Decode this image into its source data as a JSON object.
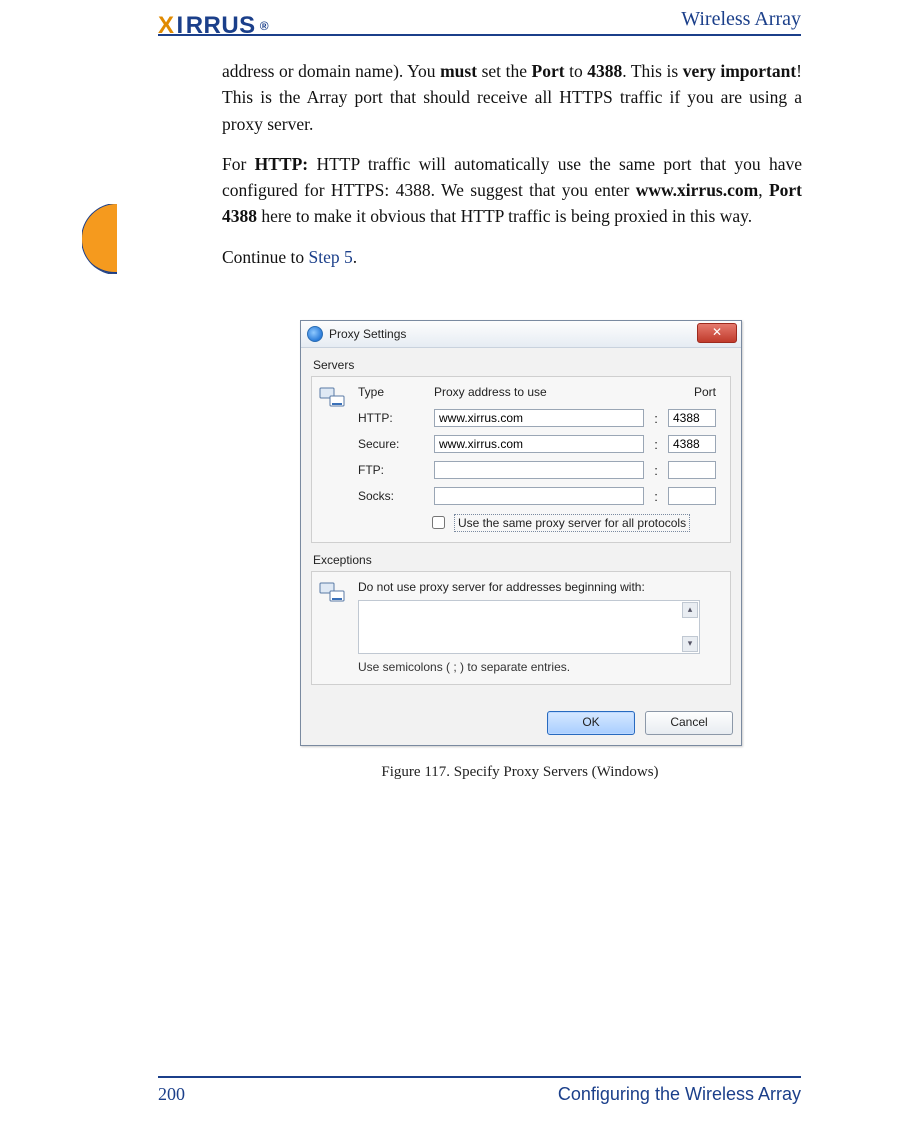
{
  "header": {
    "logo_text_1": "X",
    "logo_text_2": "I",
    "logo_text_3": "RRUS",
    "reg": "®",
    "right": "Wireless Array"
  },
  "body": {
    "p1_a": "address or domain name). You ",
    "p1_b": "must",
    "p1_c": " set the ",
    "p1_d": "Port",
    "p1_e": " to ",
    "p1_f": "4388",
    "p1_g": ". This is ",
    "p1_h": "very important",
    "p1_i": "! This is the Array port that should receive all HTTPS traffic if you are using a proxy server.",
    "p2_a": "For ",
    "p2_b": "HTTP:",
    "p2_c": " HTTP traffic will automatically use the same port that you have configured for HTTPS: 4388. We suggest that you enter ",
    "p2_d": "www.xirrus.com",
    "p2_e": ", ",
    "p2_f": "Port 4388",
    "p2_g": " here to make it obvious that HTTP traffic is being proxied in this way.",
    "p3_a": "Continue to ",
    "p3_b": "Step 5",
    "p3_c": "."
  },
  "dialog": {
    "title": "Proxy Settings",
    "close": "✕",
    "servers": {
      "group": "Servers",
      "type_hdr": "Type",
      "addr_hdr": "Proxy address to use",
      "port_hdr": "Port",
      "rows": [
        {
          "label": "HTTP:",
          "addr": "www.xirrus.com",
          "port": "4388"
        },
        {
          "label": "Secure:",
          "addr": "www.xirrus.com",
          "port": "4388"
        },
        {
          "label": "FTP:",
          "addr": "",
          "port": ""
        },
        {
          "label": "Socks:",
          "addr": "",
          "port": ""
        }
      ],
      "same": "Use the same proxy server for all protocols"
    },
    "exceptions": {
      "group": "Exceptions",
      "label": "Do not use proxy server for addresses beginning with:",
      "hint": "Use semicolons ( ; ) to separate entries."
    },
    "buttons": {
      "ok": "OK",
      "cancel": "Cancel"
    }
  },
  "figure_caption": "Figure 117. Specify Proxy Servers (Windows)",
  "footer": {
    "page": "200",
    "section": "Configuring the Wireless Array"
  }
}
